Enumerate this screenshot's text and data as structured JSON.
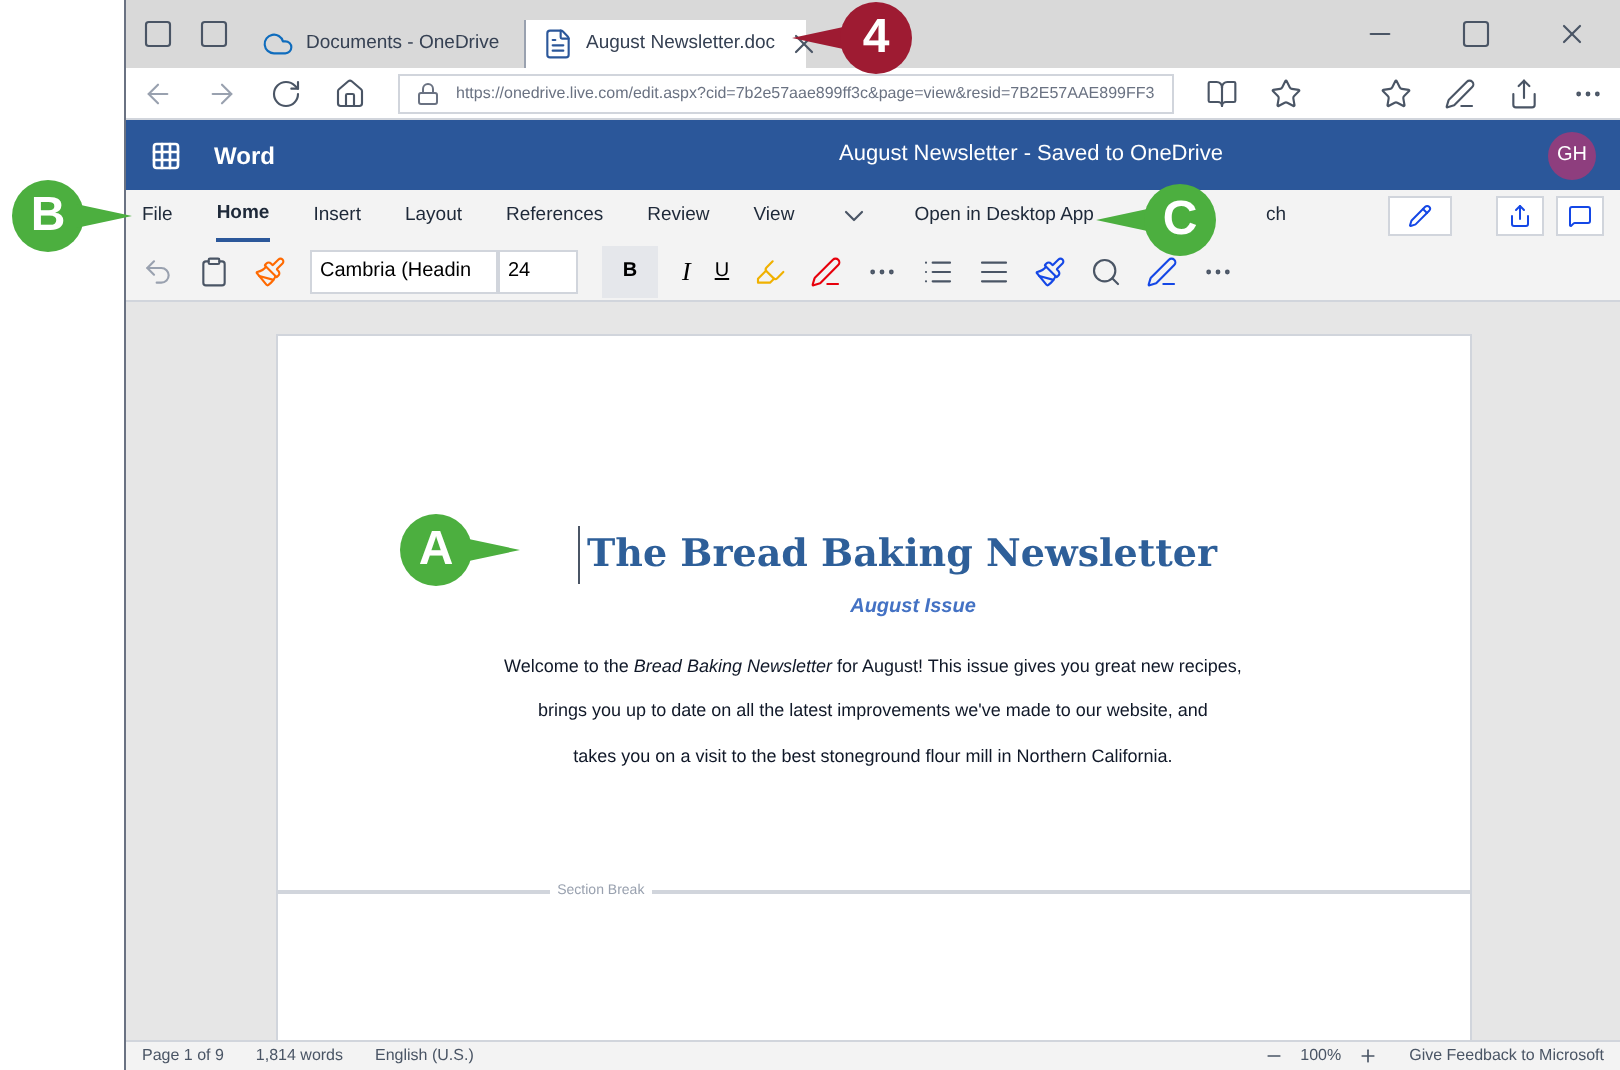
{
  "browser": {
    "tabs": [
      {
        "label": "Documents - OneDrive",
        "selected": false
      },
      {
        "label": "August Newsletter.doc",
        "selected": true
      }
    ],
    "url": "https://onedrive.live.com/edit.aspx?cid=7b2e57aae899ff3c&page=view&resid=7B2E57AAE899FF3"
  },
  "app": {
    "name": "Word",
    "doc_title": "August Newsletter - Saved to OneDrive",
    "user_initials": "GH"
  },
  "ribbon_tabs": [
    {
      "label": "File",
      "selected": false
    },
    {
      "label": "Home",
      "selected": true
    },
    {
      "label": "Insert",
      "selected": false
    },
    {
      "label": "Layout",
      "selected": false
    },
    {
      "label": "References",
      "selected": false
    },
    {
      "label": "Review",
      "selected": false
    },
    {
      "label": "View",
      "selected": false
    }
  ],
  "open_desktop": "Open in Desktop App",
  "search_tab": "ch",
  "toolbar": {
    "font": "Cambria (Headin",
    "size": "24",
    "bold": "B",
    "italic": "I",
    "underline": "U"
  },
  "document": {
    "title": "The Bread Baking Newsletter",
    "subtitle": "August Issue",
    "lines": [
      "Welcome to the *Bread Baking Newsletter* for August! This issue gives you great new recipes,",
      "brings you up to date on all the latest improvements we've made to our website, and",
      "takes you on a visit to the best stoneground flour mill in Northern California."
    ],
    "section_break": "Section Break"
  },
  "status_bar": {
    "page": "Page 1 of 9",
    "words": "1,814 words",
    "language": "English (U.S.)",
    "zoom": "100%",
    "feedback": "Give Feedback to Microsoft"
  },
  "callouts": [
    {
      "label": "4",
      "color": "#9e1b32"
    },
    {
      "label": "A",
      "color": "#4caf3f"
    },
    {
      "label": "B",
      "color": "#4caf3f"
    },
    {
      "label": "C",
      "color": "#4caf3f"
    }
  ]
}
